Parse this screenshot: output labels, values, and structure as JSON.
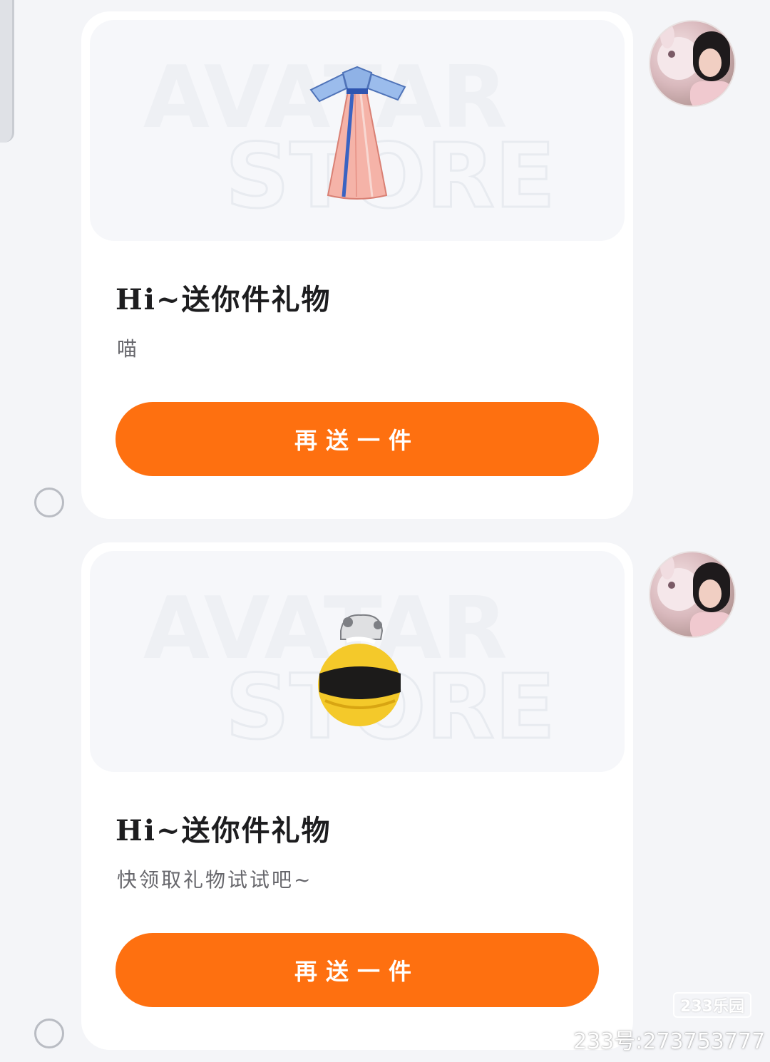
{
  "messages": [
    {
      "item": "hanfu-dress",
      "watermark_line1": "AVATAR",
      "watermark_line2": "STORE",
      "title": "Hi~送你件礼物",
      "message": "喵",
      "button_label": "再送一件"
    },
    {
      "item": "bee-bag",
      "watermark_line1": "AVATAR",
      "watermark_line2": "STORE",
      "title": "Hi~送你件礼物",
      "message": "快领取礼物试试吧~",
      "button_label": "再送一件"
    }
  ],
  "site_watermark": {
    "logo_text": "233乐园",
    "id_text": "233号:273753777"
  },
  "colors": {
    "accent": "#fe7010",
    "background": "#f4f5f8",
    "card": "#ffffff"
  }
}
